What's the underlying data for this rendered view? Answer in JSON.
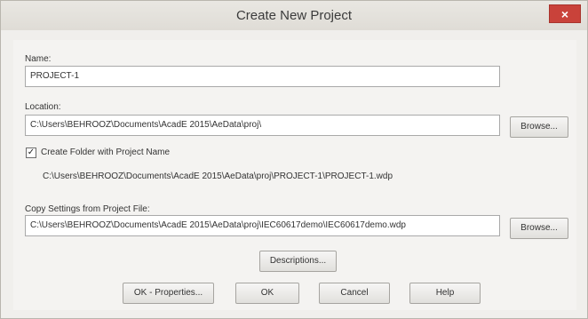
{
  "dialog": {
    "title": "Create New Project",
    "close_glyph": "×"
  },
  "name": {
    "label": "Name:",
    "value": "PROJECT-1"
  },
  "location": {
    "label": "Location:",
    "value": "C:\\Users\\BEHROOZ\\Documents\\AcadE 2015\\AeData\\proj\\",
    "browse_label": "Browse..."
  },
  "create_folder": {
    "checked": true,
    "check_glyph": "✓",
    "label": "Create Folder with Project Name",
    "result_path": "C:\\Users\\BEHROOZ\\Documents\\AcadE 2015\\AeData\\proj\\PROJECT-1\\PROJECT-1.wdp"
  },
  "copy_settings": {
    "label": "Copy Settings from Project File:",
    "value": "C:\\Users\\BEHROOZ\\Documents\\AcadE 2015\\AeData\\proj\\IEC60617demo\\IEC60617demo.wdp",
    "browse_label": "Browse..."
  },
  "buttons": {
    "descriptions": "Descriptions...",
    "ok_properties": "OK - Properties...",
    "ok": "OK",
    "cancel": "Cancel",
    "help": "Help"
  },
  "icons": {
    "close": "close-icon",
    "check": "checkmark-icon"
  },
  "colors": {
    "close_button": "#c9423a",
    "dialog_bg": "#f0efec"
  }
}
